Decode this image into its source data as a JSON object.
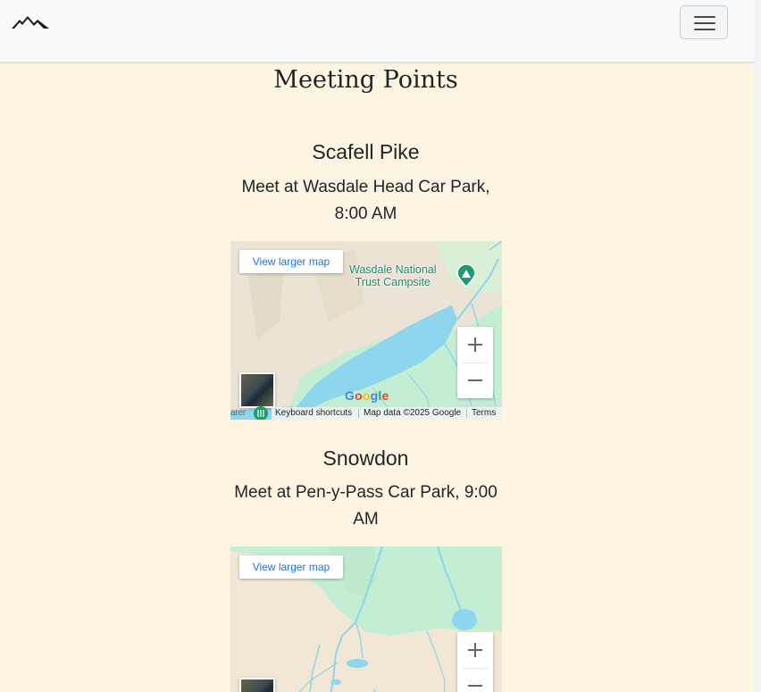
{
  "navbar": {
    "logo_icon": "mountains-icon",
    "menu_icon": "hamburger-menu-icon"
  },
  "page_title": "Meeting Points",
  "meetings": [
    {
      "name": "Scafell Pike",
      "detail": "Meet at Wasdale Head Car Park, 8:00 AM",
      "map": {
        "view_larger_label": "View larger map",
        "place_label_line1": "Wasdale National",
        "place_label_line2": "Trust Campsite",
        "edge_label": "ater",
        "attribution": {
          "shortcuts": "Keyboard shortcuts",
          "map_data": "Map data ©2025 Google",
          "terms": "Terms"
        },
        "colors": {
          "land": "#ebe4d6",
          "water": "#8dd6ee",
          "park": "#c4eed4"
        }
      }
    },
    {
      "name": "Snowdon",
      "detail": "Meet at Pen-y-Pass Car Park, 9:00 AM",
      "map": {
        "view_larger_label": "View larger map",
        "colors": {
          "land": "#f1e7d4",
          "water": "#8dd6ee",
          "park": "#c4eed4"
        }
      }
    }
  ],
  "google_logo": [
    "G",
    "o",
    "o",
    "g",
    "l",
    "e"
  ],
  "google_colors": [
    "#4285f4",
    "#ea4335",
    "#fbbc05",
    "#4285f4",
    "#34a853",
    "#ea4335"
  ]
}
